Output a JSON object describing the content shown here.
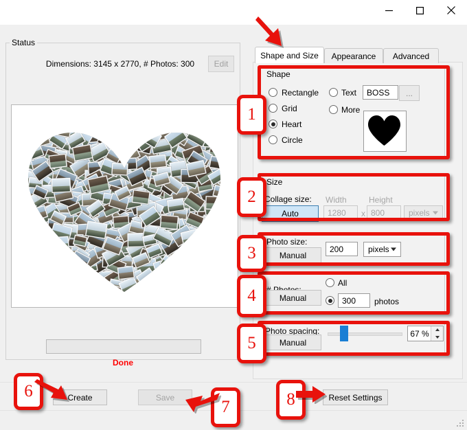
{
  "window": {
    "minimize": "minimize-icon",
    "maximize": "maximize-icon",
    "close": "close-icon"
  },
  "left_panel": {
    "group_title": "Status",
    "dimensions_text": "Dimensions: 3145 x 2770, # Photos: 300",
    "edit_label": "Edit",
    "progress_value": "",
    "status_text": "Done",
    "status_color": "#ff0000",
    "create_label": "Create",
    "save_label": "Save",
    "preview_alt": "heart-shaped-photo-collage"
  },
  "tabs": [
    {
      "label": "Shape and Size",
      "active": true
    },
    {
      "label": "Appearance",
      "active": false
    },
    {
      "label": "Advanced",
      "active": false
    }
  ],
  "shape": {
    "group_title": "Shape",
    "options": [
      {
        "label": "Rectangle",
        "selected": false
      },
      {
        "label": "Grid",
        "selected": false
      },
      {
        "label": "Heart",
        "selected": true
      },
      {
        "label": "Circle",
        "selected": false
      }
    ],
    "text_option": {
      "label": "Text",
      "selected": false
    },
    "text_value": "BOSS",
    "browse_label": "...",
    "more_option": {
      "label": "More",
      "selected": false
    },
    "preview_shape": "heart"
  },
  "size": {
    "group_title": "Size",
    "collage_size_label": "Collage size:",
    "mode_button": "Auto",
    "width_label": "Width",
    "width_value": "1280",
    "times": "x",
    "height_label": "Height",
    "height_value": "800",
    "units": "pixels"
  },
  "photo_size": {
    "label": "Photo size:",
    "mode_button": "Manual",
    "value": "200",
    "units": "pixels"
  },
  "num_photos": {
    "label": "# Photos:",
    "mode_button": "Manual",
    "all_option": {
      "label": "All",
      "selected": false
    },
    "count_selected": true,
    "count_value": "300",
    "count_suffix": "photos"
  },
  "photo_spacing": {
    "label": "Photo spacing:",
    "mode_button": "Manual",
    "value": "67 %",
    "slider_percent": 67
  },
  "footer": {
    "reset_label": "Reset Settings"
  },
  "annotations": {
    "accent_color": "#e8120c",
    "badges": [
      "1",
      "2",
      "3",
      "4",
      "5",
      "6",
      "7",
      "8"
    ]
  }
}
